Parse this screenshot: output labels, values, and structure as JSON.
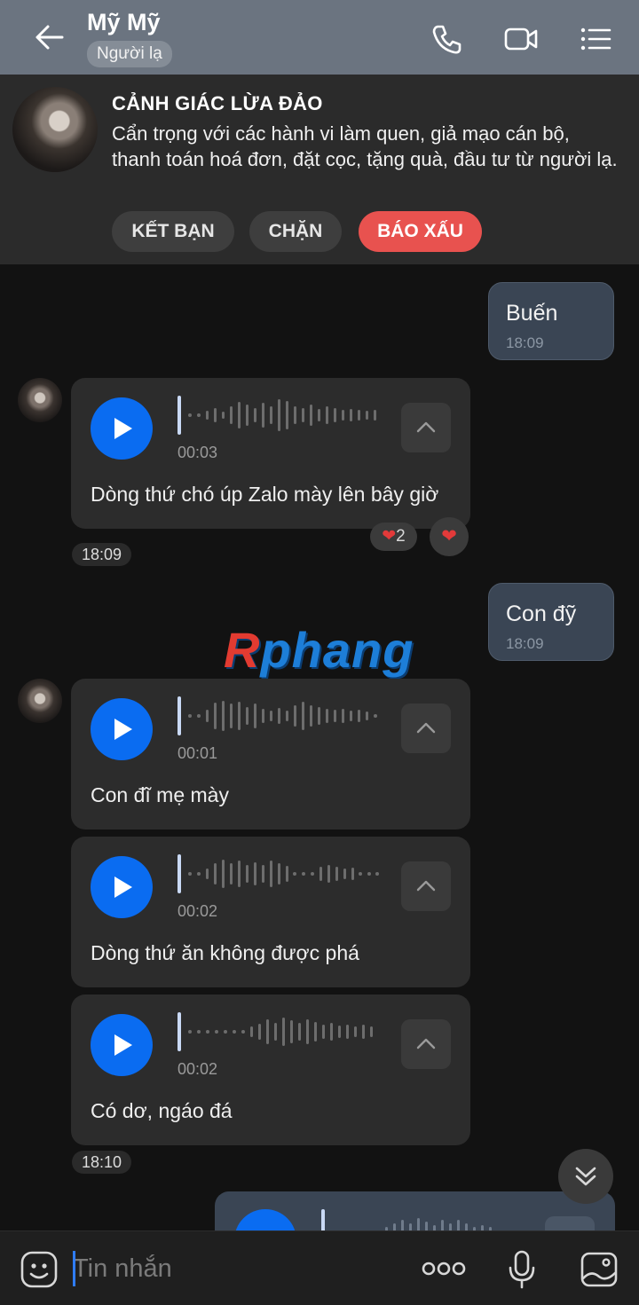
{
  "header": {
    "title": "Mỹ Mỹ",
    "badge": "Người lạ",
    "icons": [
      "back-arrow-icon",
      "phone-icon",
      "video-call-icon",
      "menu-list-icon"
    ]
  },
  "banner": {
    "title": "CẢNH GIÁC LỪA ĐẢO",
    "text": "Cẩn trọng với các hành vi làm quen, giả mạo cán bộ, thanh toán hoá đơn, đặt cọc, tặng quà, đầu tư từ người lạ.",
    "buttons": {
      "add_friend": "KẾT BẠN",
      "block": "CHẶN",
      "report": "BÁO XẤU"
    }
  },
  "messages": {
    "m1": {
      "text": "Buến",
      "time": "18:09"
    },
    "v1": {
      "duration": "00:03",
      "text": "Dòng thứ chó úp Zalo mày lên bây giờ",
      "reaction_count": "2",
      "time": "18:09"
    },
    "m2": {
      "text": "Con đỹ",
      "time": "18:09"
    },
    "v2": {
      "duration": "00:01",
      "text": "Con đĩ mẹ mày"
    },
    "v3": {
      "duration": "00:02",
      "text": "Dòng thứ ăn không được phá"
    },
    "v4": {
      "duration": "00:02",
      "text": "Có dơ, ngáo đá",
      "time": "18:10"
    }
  },
  "watermark": {
    "first": "R",
    "rest": "phang"
  },
  "input": {
    "placeholder": "Tin nhắn"
  },
  "colors": {
    "header": "#6b7480",
    "accent_blue": "#0a6cf1",
    "report_red": "#e8524f",
    "my_bubble": "#3a4554"
  }
}
